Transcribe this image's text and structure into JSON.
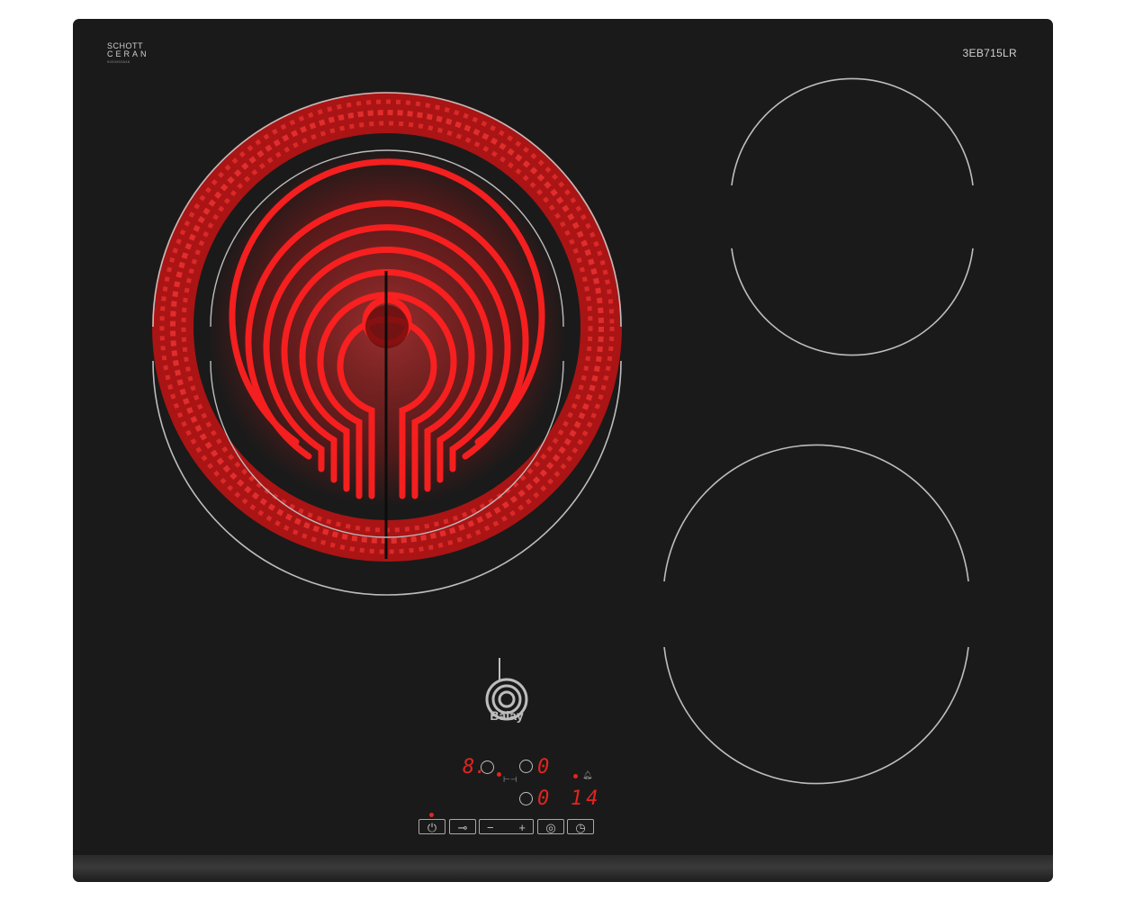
{
  "brand": {
    "glass_logo_line1": "SCHOTT",
    "glass_logo_line2": "CERAN",
    "glass_logo_code": "9000903848",
    "model": "3EB715LR",
    "name": "Balay"
  },
  "colors": {
    "glass": "#1a1a1a",
    "heating_red": "#e0251f",
    "zone_outline": "#bdbdbd"
  },
  "display": {
    "zone_level": "8.",
    "zone_select_icon": "dual-zone-icon",
    "value_top": "0",
    "value_bottom": "0",
    "timer_minutes": "14",
    "timer_icon": "bell-icon",
    "link_icon": "link-icon"
  },
  "controls": {
    "power": "power-icon",
    "lock": "key-icon",
    "minus": "−",
    "plus": "+",
    "zone_extension": "dual-zone-icon",
    "timer": "clock-icon"
  }
}
